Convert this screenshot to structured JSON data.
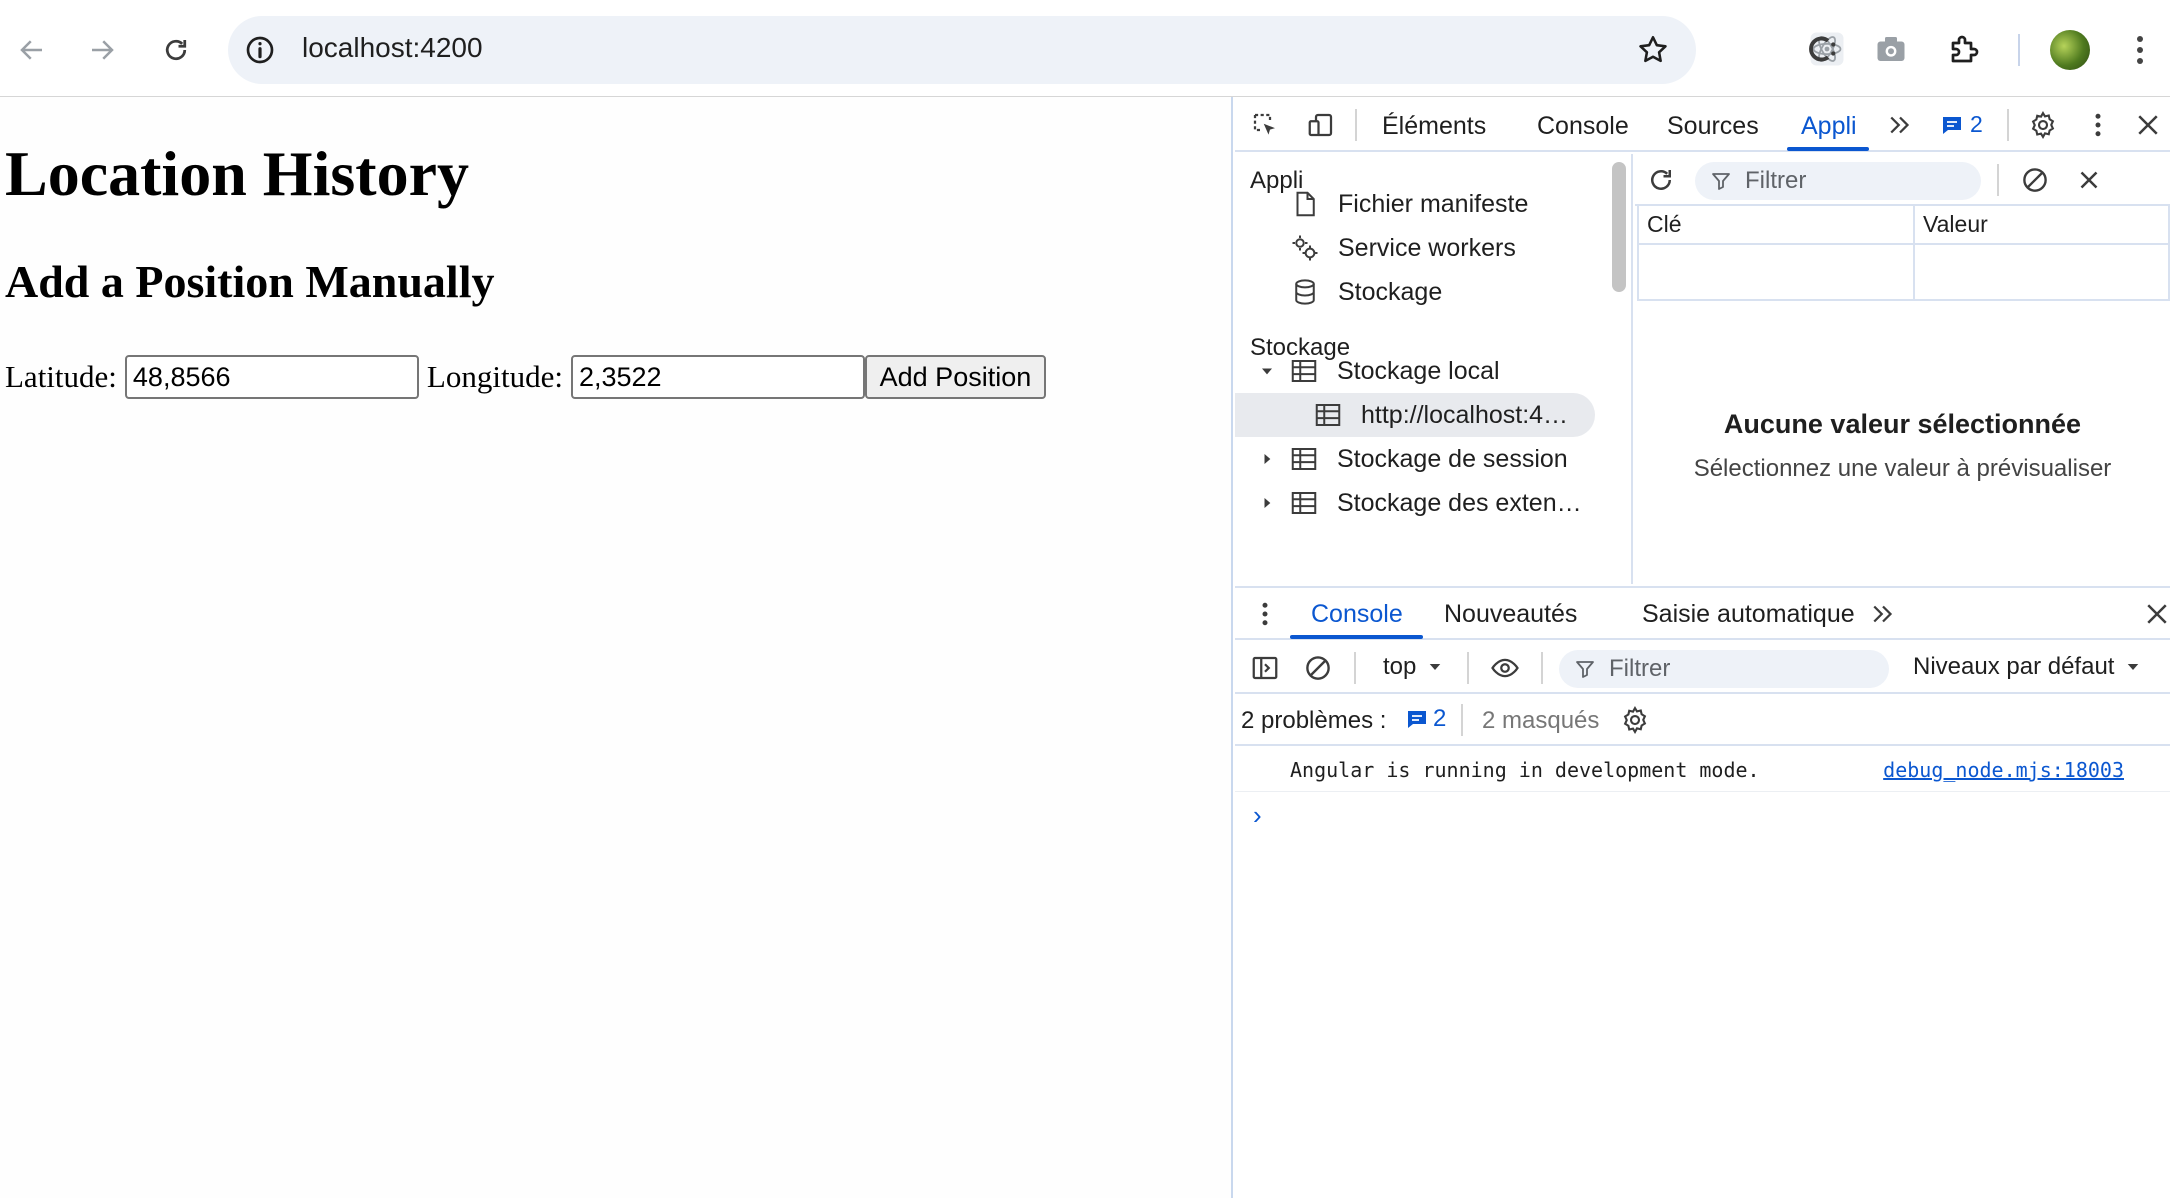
{
  "browser": {
    "url": "localhost:4200"
  },
  "page": {
    "title": "Location History",
    "subtitle": "Add a Position Manually",
    "form": {
      "latitude_label": "Latitude:",
      "latitude_value": "48,8566",
      "longitude_label": "Longitude:",
      "longitude_value": "2,3522",
      "add_button": "Add Position"
    }
  },
  "devtools": {
    "tabs": [
      {
        "label": "Éléments"
      },
      {
        "label": "Console"
      },
      {
        "label": "Sources"
      },
      {
        "label": "Appli",
        "active": true
      }
    ],
    "more_tabs": "»",
    "issues_count": "2",
    "sidebar": {
      "app_heading": "Appli",
      "app_items": [
        "Fichier manifeste",
        "Service workers",
        "Stockage"
      ],
      "storage_heading": "Stockage",
      "storage_items": [
        "Stockage local",
        "http://localhost:4…",
        "Stockage de session",
        "Stockage des exten…"
      ]
    },
    "storage_pane": {
      "filter_placeholder": "Filtrer",
      "columns": [
        "Clé",
        "Valeur"
      ],
      "empty_title": "Aucune valeur sélectionnée",
      "empty_subtitle": "Sélectionnez une valeur à prévisualiser"
    },
    "drawer": {
      "tabs": [
        "Console",
        "Nouveautés",
        "Saisie automatique"
      ],
      "context": "top",
      "filter_placeholder": "Filtrer",
      "levels": "Niveaux par défaut",
      "problems_label": "2 problèmes :",
      "problems_count": "2",
      "hidden_label": "2 masqués",
      "log_message": "Angular is running in development mode.",
      "log_source": "debug_node.mjs:18003",
      "prompt": "›"
    },
    "accent_color": "#0b57d0"
  }
}
